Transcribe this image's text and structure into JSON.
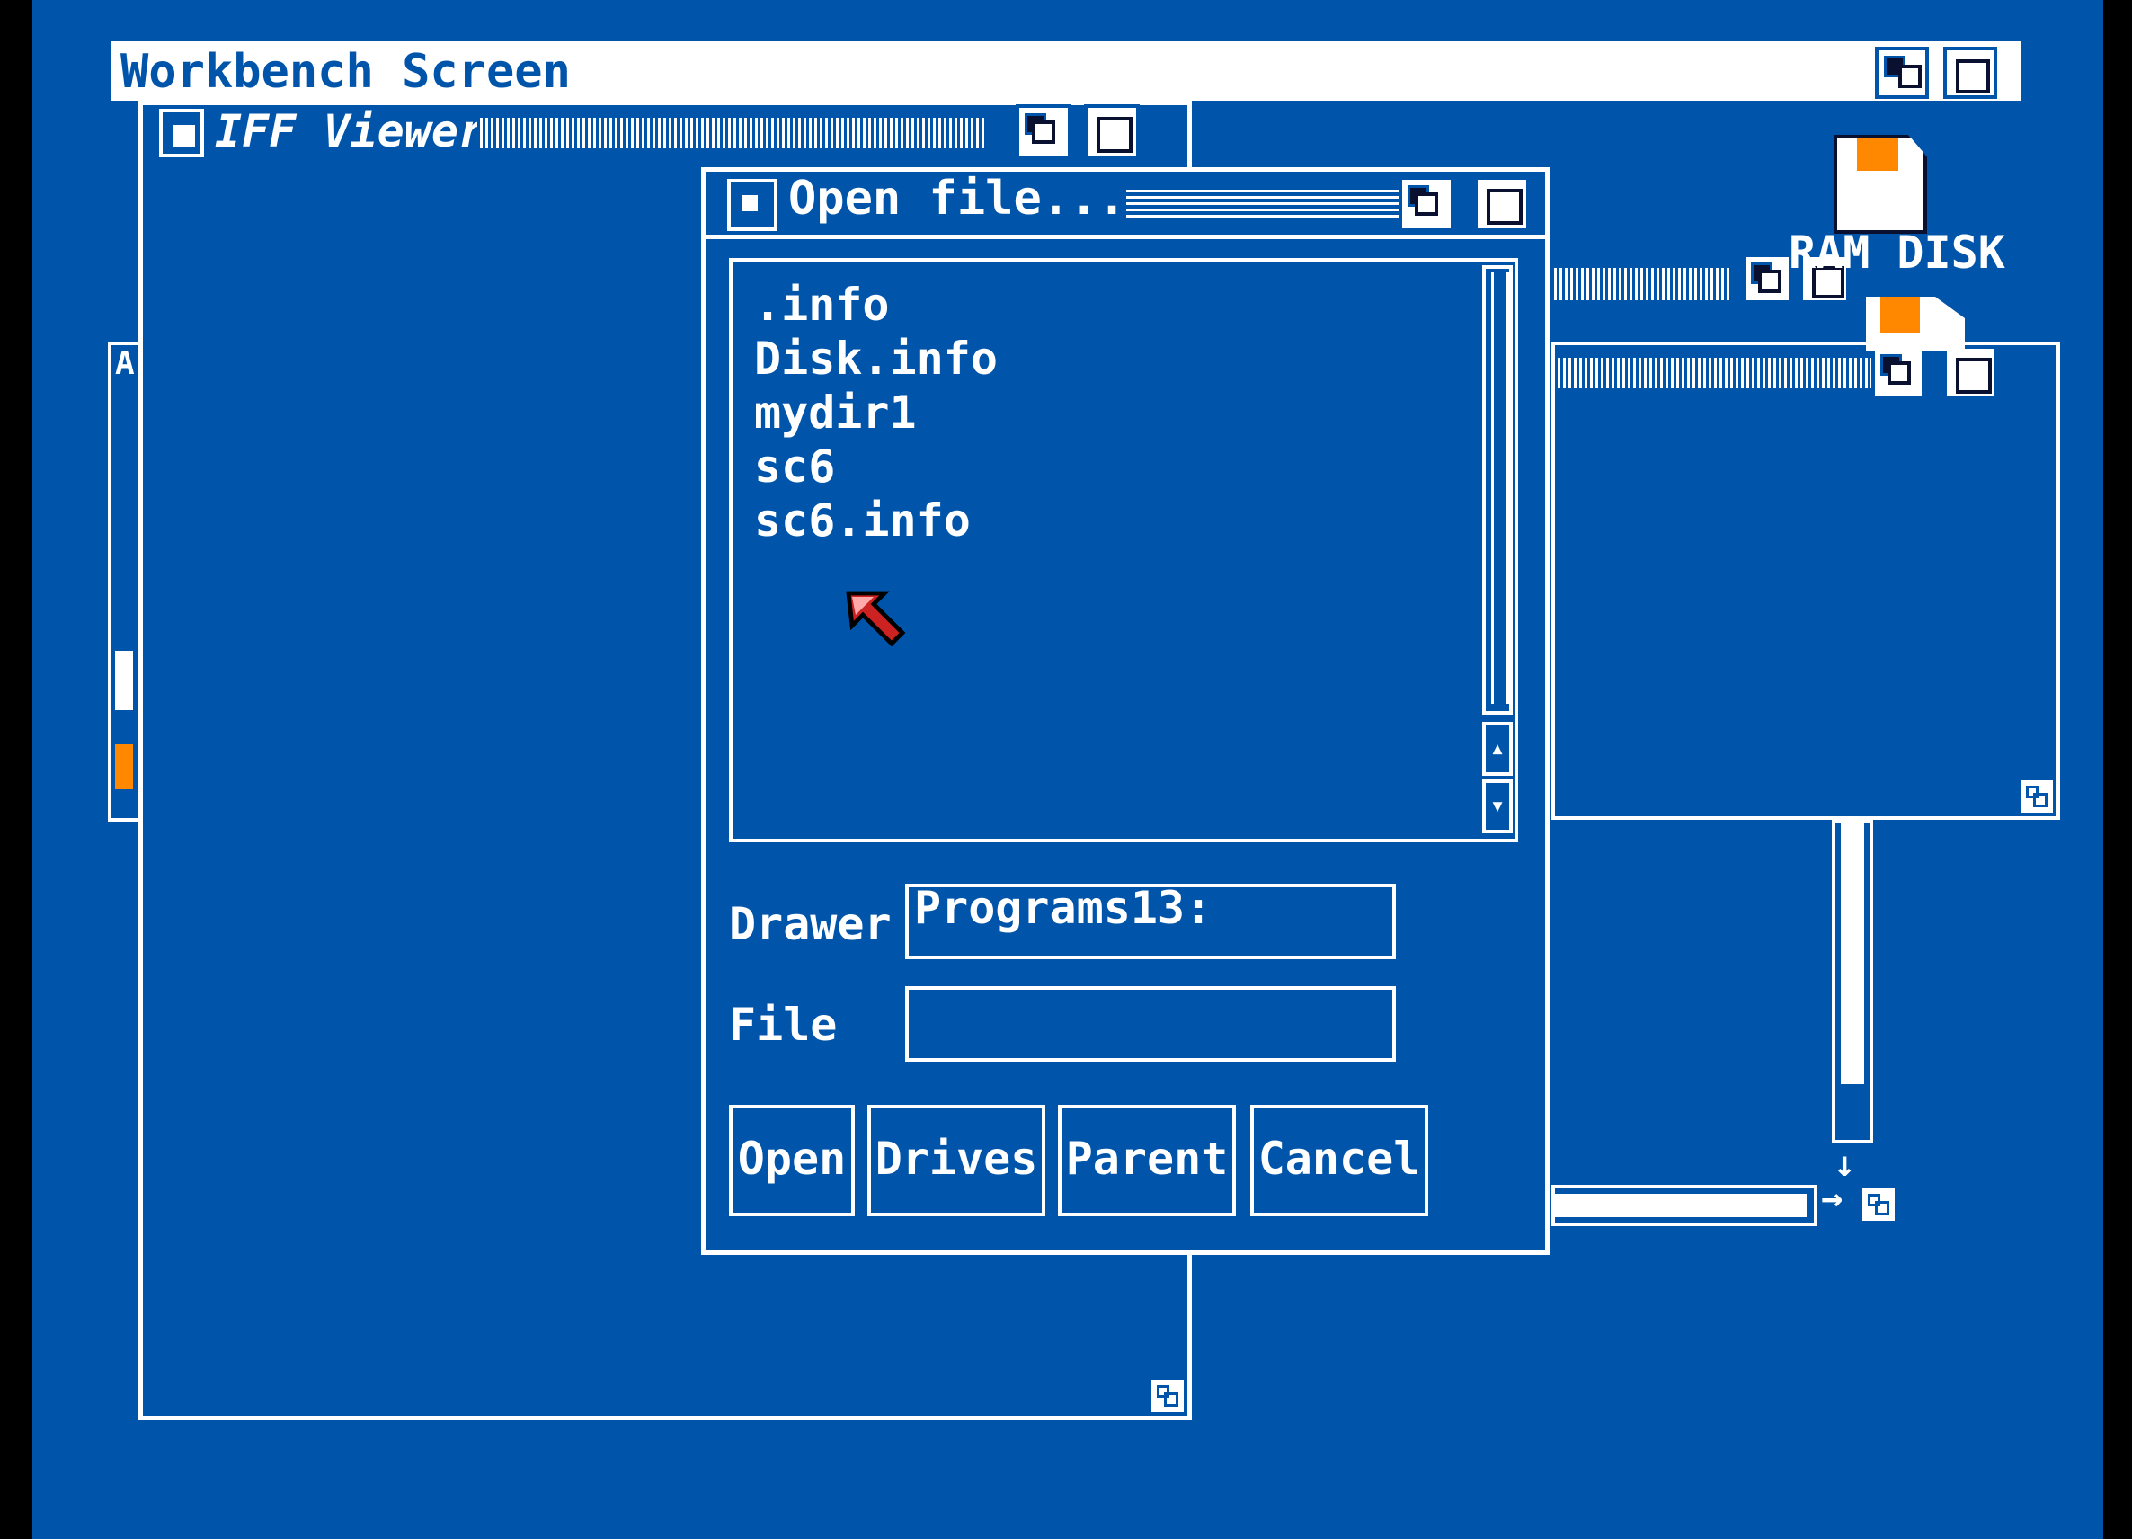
{
  "screen": {
    "title": "Workbench Screen"
  },
  "iff_window": {
    "title": "IFF Viewer"
  },
  "disk_icon": {
    "label": "RAM DISK"
  },
  "dialog": {
    "title": "Open file...",
    "files": [
      ".info",
      "Disk.info",
      "mydir1",
      "sc6",
      "sc6.info"
    ],
    "drawer_label": "Drawer",
    "drawer_value": "Programs13:",
    "file_label": "File",
    "file_value": "",
    "buttons": {
      "open": "Open",
      "drives": "Drives",
      "parent": "Parent",
      "cancel": "Cancel"
    }
  },
  "colors": {
    "background": "#0055aa",
    "foreground": "#ffffff",
    "accent": "#ff8800",
    "dark": "#0a1030",
    "pointer": "#cc2222"
  }
}
